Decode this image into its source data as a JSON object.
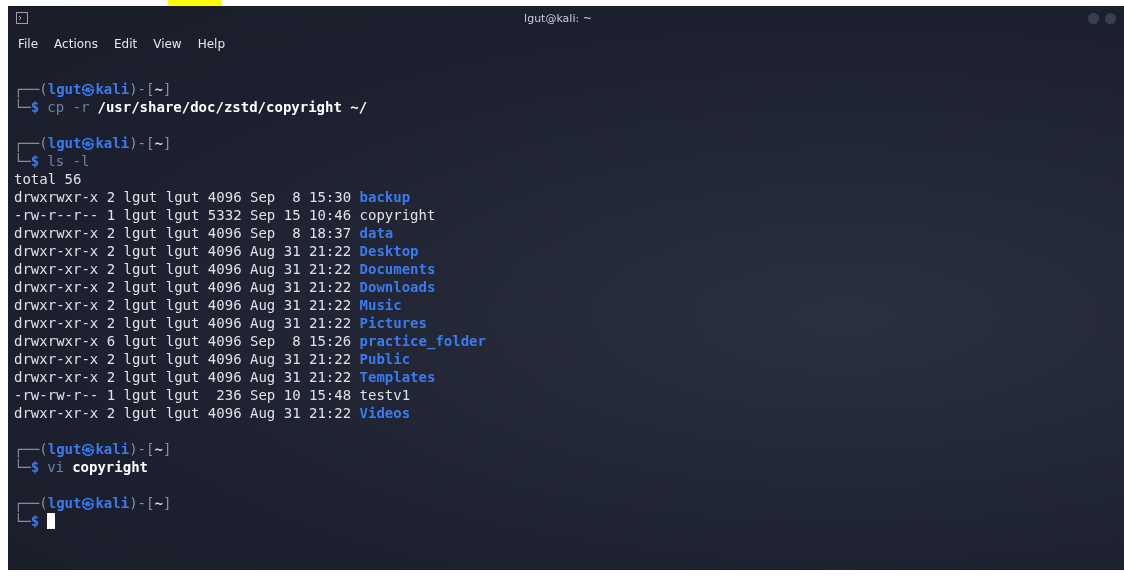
{
  "window": {
    "title": "lgut@kali: ~"
  },
  "menu": [
    "File",
    "Actions",
    "Edit",
    "View",
    "Help"
  ],
  "blocks": [
    {
      "prompt": [
        {
          "kind": "frame",
          "text": "┌──("
        },
        {
          "kind": "user",
          "text": "lgut㉿kali"
        },
        {
          "kind": "frame",
          "text": ")-["
        },
        {
          "kind": "dir",
          "text": "~"
        },
        {
          "kind": "frame",
          "text": "]"
        }
      ],
      "input": [
        {
          "kind": "frame",
          "text": "└─"
        },
        {
          "kind": "sigil",
          "text": "$"
        },
        {
          "kind": "cmd",
          "text": "cp -r"
        },
        {
          "kind": "arg",
          "text": "/usr/share/doc/zstd/copyright ~/"
        }
      ]
    },
    {
      "prompt": [
        {
          "kind": "frame",
          "text": "┌──("
        },
        {
          "kind": "user",
          "text": "lgut㉿kali"
        },
        {
          "kind": "frame",
          "text": ")-["
        },
        {
          "kind": "dir",
          "text": "~"
        },
        {
          "kind": "frame",
          "text": "]"
        }
      ],
      "input": [
        {
          "kind": "frame",
          "text": "└─"
        },
        {
          "kind": "sigil",
          "text": "$"
        },
        {
          "kind": "cmd",
          "text": "ls -l"
        }
      ],
      "output": [
        {
          "kind": "text",
          "meta": "total 56"
        },
        {
          "kind": "dir",
          "meta": "drwxrwxr-x 2 lgut lgut 4096 Sep  8 15:30",
          "name": "backup"
        },
        {
          "kind": "file",
          "meta": "-rw-r--r-- 1 lgut lgut 5332 Sep 15 10:46",
          "name": "copyright"
        },
        {
          "kind": "dir",
          "meta": "drwxrwxr-x 2 lgut lgut 4096 Sep  8 18:37",
          "name": "data"
        },
        {
          "kind": "dir",
          "meta": "drwxr-xr-x 2 lgut lgut 4096 Aug 31 21:22",
          "name": "Desktop"
        },
        {
          "kind": "dir",
          "meta": "drwxr-xr-x 2 lgut lgut 4096 Aug 31 21:22",
          "name": "Documents"
        },
        {
          "kind": "dir",
          "meta": "drwxr-xr-x 2 lgut lgut 4096 Aug 31 21:22",
          "name": "Downloads"
        },
        {
          "kind": "dir",
          "meta": "drwxr-xr-x 2 lgut lgut 4096 Aug 31 21:22",
          "name": "Music"
        },
        {
          "kind": "dir",
          "meta": "drwxr-xr-x 2 lgut lgut 4096 Aug 31 21:22",
          "name": "Pictures"
        },
        {
          "kind": "dir",
          "meta": "drwxrwxr-x 6 lgut lgut 4096 Sep  8 15:26",
          "name": "practice_folder"
        },
        {
          "kind": "dir",
          "meta": "drwxr-xr-x 2 lgut lgut 4096 Aug 31 21:22",
          "name": "Public"
        },
        {
          "kind": "dir",
          "meta": "drwxr-xr-x 2 lgut lgut 4096 Aug 31 21:22",
          "name": "Templates"
        },
        {
          "kind": "file",
          "meta": "-rw-rw-r-- 1 lgut lgut  236 Sep 10 15:48",
          "name": "testv1"
        },
        {
          "kind": "dir",
          "meta": "drwxr-xr-x 2 lgut lgut 4096 Aug 31 21:22",
          "name": "Videos"
        }
      ]
    },
    {
      "prompt": [
        {
          "kind": "frame",
          "text": "┌──("
        },
        {
          "kind": "user",
          "text": "lgut㉿kali"
        },
        {
          "kind": "frame",
          "text": ")-["
        },
        {
          "kind": "dir",
          "text": "~"
        },
        {
          "kind": "frame",
          "text": "]"
        }
      ],
      "input": [
        {
          "kind": "frame",
          "text": "└─"
        },
        {
          "kind": "sigil",
          "text": "$"
        },
        {
          "kind": "cmd",
          "text": "vi"
        },
        {
          "kind": "arg",
          "text": "copyright"
        }
      ]
    },
    {
      "prompt": [
        {
          "kind": "frame",
          "text": "┌──("
        },
        {
          "kind": "user",
          "text": "lgut㉿kali"
        },
        {
          "kind": "frame",
          "text": ")-["
        },
        {
          "kind": "dir",
          "text": "~"
        },
        {
          "kind": "frame",
          "text": "]"
        }
      ],
      "input": [
        {
          "kind": "frame",
          "text": "└─"
        },
        {
          "kind": "sigil",
          "text": "$"
        }
      ],
      "cursor": true
    }
  ]
}
